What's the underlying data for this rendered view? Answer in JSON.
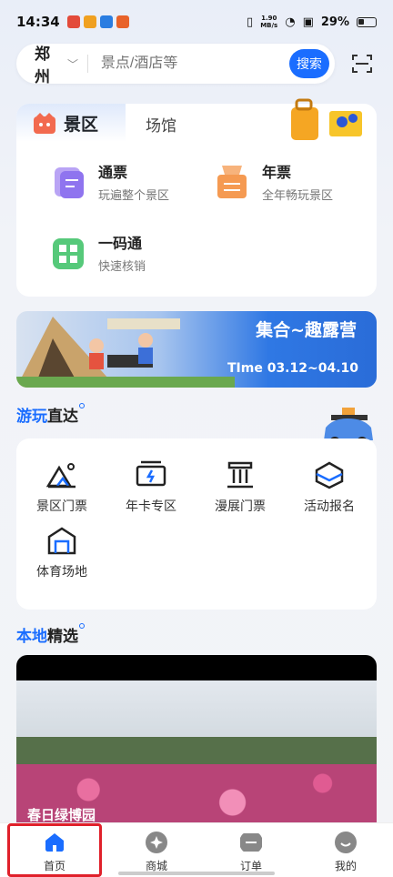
{
  "status_bar": {
    "time": "14:34",
    "speed_value": "1.90",
    "speed_unit": "MB/s",
    "battery": "29%"
  },
  "search": {
    "city": "郑州",
    "placeholder": "景点/酒店等",
    "button": "搜索"
  },
  "ticket_tabs": {
    "active": "景区",
    "inactive": "场馆"
  },
  "ticket_items": [
    {
      "title": "通票",
      "subtitle": "玩遍整个景区"
    },
    {
      "title": "年票",
      "subtitle": "全年畅玩景区"
    },
    {
      "title": "一码通",
      "subtitle": "快速核销"
    }
  ],
  "banner": {
    "title": "集合~趣露营",
    "date": "TIme 03.12~04.10"
  },
  "section_play": {
    "highlight": "游玩",
    "rest": "直达"
  },
  "nav_items": [
    {
      "label": "景区门票",
      "icon": "mountain-ticket-icon"
    },
    {
      "label": "年卡专区",
      "icon": "card-icon"
    },
    {
      "label": "漫展门票",
      "icon": "museum-icon"
    },
    {
      "label": "活动报名",
      "icon": "ring-icon"
    },
    {
      "label": "体育场地",
      "icon": "stadium-icon"
    }
  ],
  "section_local": {
    "highlight": "本地",
    "rest": "精选"
  },
  "photo": {
    "caption": "春日绿博园"
  },
  "bottom_nav": [
    {
      "label": "首页",
      "icon": "home-icon",
      "active": true
    },
    {
      "label": "商城",
      "icon": "mall-icon"
    },
    {
      "label": "订单",
      "icon": "order-icon"
    },
    {
      "label": "我的",
      "icon": "profile-icon"
    }
  ],
  "colors": {
    "accent": "#1a6dff",
    "highlight_box": "#e0202a"
  }
}
